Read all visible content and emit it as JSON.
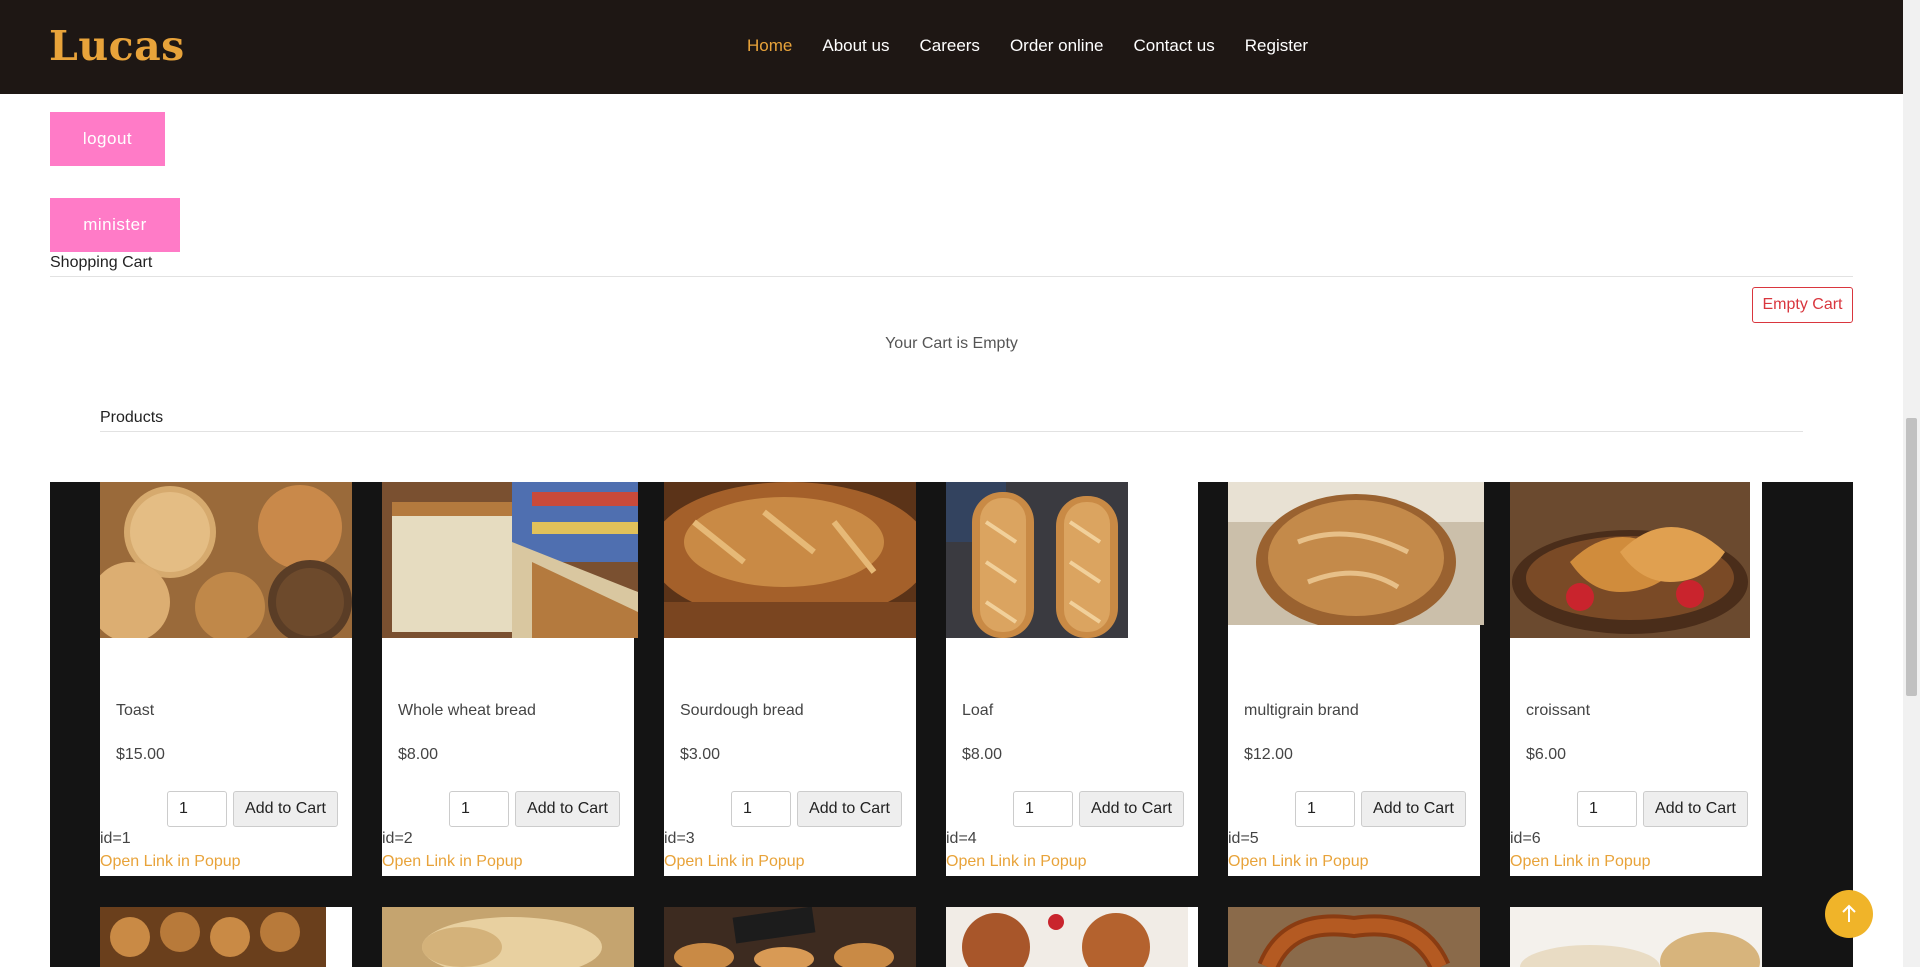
{
  "header": {
    "brand": "Lucas",
    "nav": [
      "Home",
      "About us",
      "Careers",
      "Order online",
      "Contact us",
      "Register"
    ],
    "active_nav": "Home"
  },
  "buttons": {
    "logout": "logout",
    "minister": "minister"
  },
  "cart": {
    "title": "Shopping Cart",
    "empty_button": "Empty Cart",
    "empty_message": "Your Cart is Empty"
  },
  "products": {
    "title": "Products",
    "add_label": "Add to Cart",
    "popup_label": "Open Link in Popup",
    "items": [
      {
        "name": "Toast",
        "price": "$15.00",
        "qty": "1",
        "id": "id=1"
      },
      {
        "name": "Whole wheat bread",
        "price": "$8.00",
        "qty": "1",
        "id": "id=2"
      },
      {
        "name": "Sourdough bread",
        "price": "$3.00",
        "qty": "1",
        "id": "id=3"
      },
      {
        "name": "Loaf",
        "price": "$8.00",
        "qty": "1",
        "id": "id=4"
      },
      {
        "name": "multigrain brand",
        "price": "$12.00",
        "qty": "1",
        "id": "id=5"
      },
      {
        "name": "croissant",
        "price": "$6.00",
        "qty": "1",
        "id": "id=6"
      }
    ]
  },
  "colors": {
    "header_bg": "#1e1714",
    "accent": "#e8a33a",
    "pink": "#ff7bc7",
    "danger": "#d9363e"
  }
}
